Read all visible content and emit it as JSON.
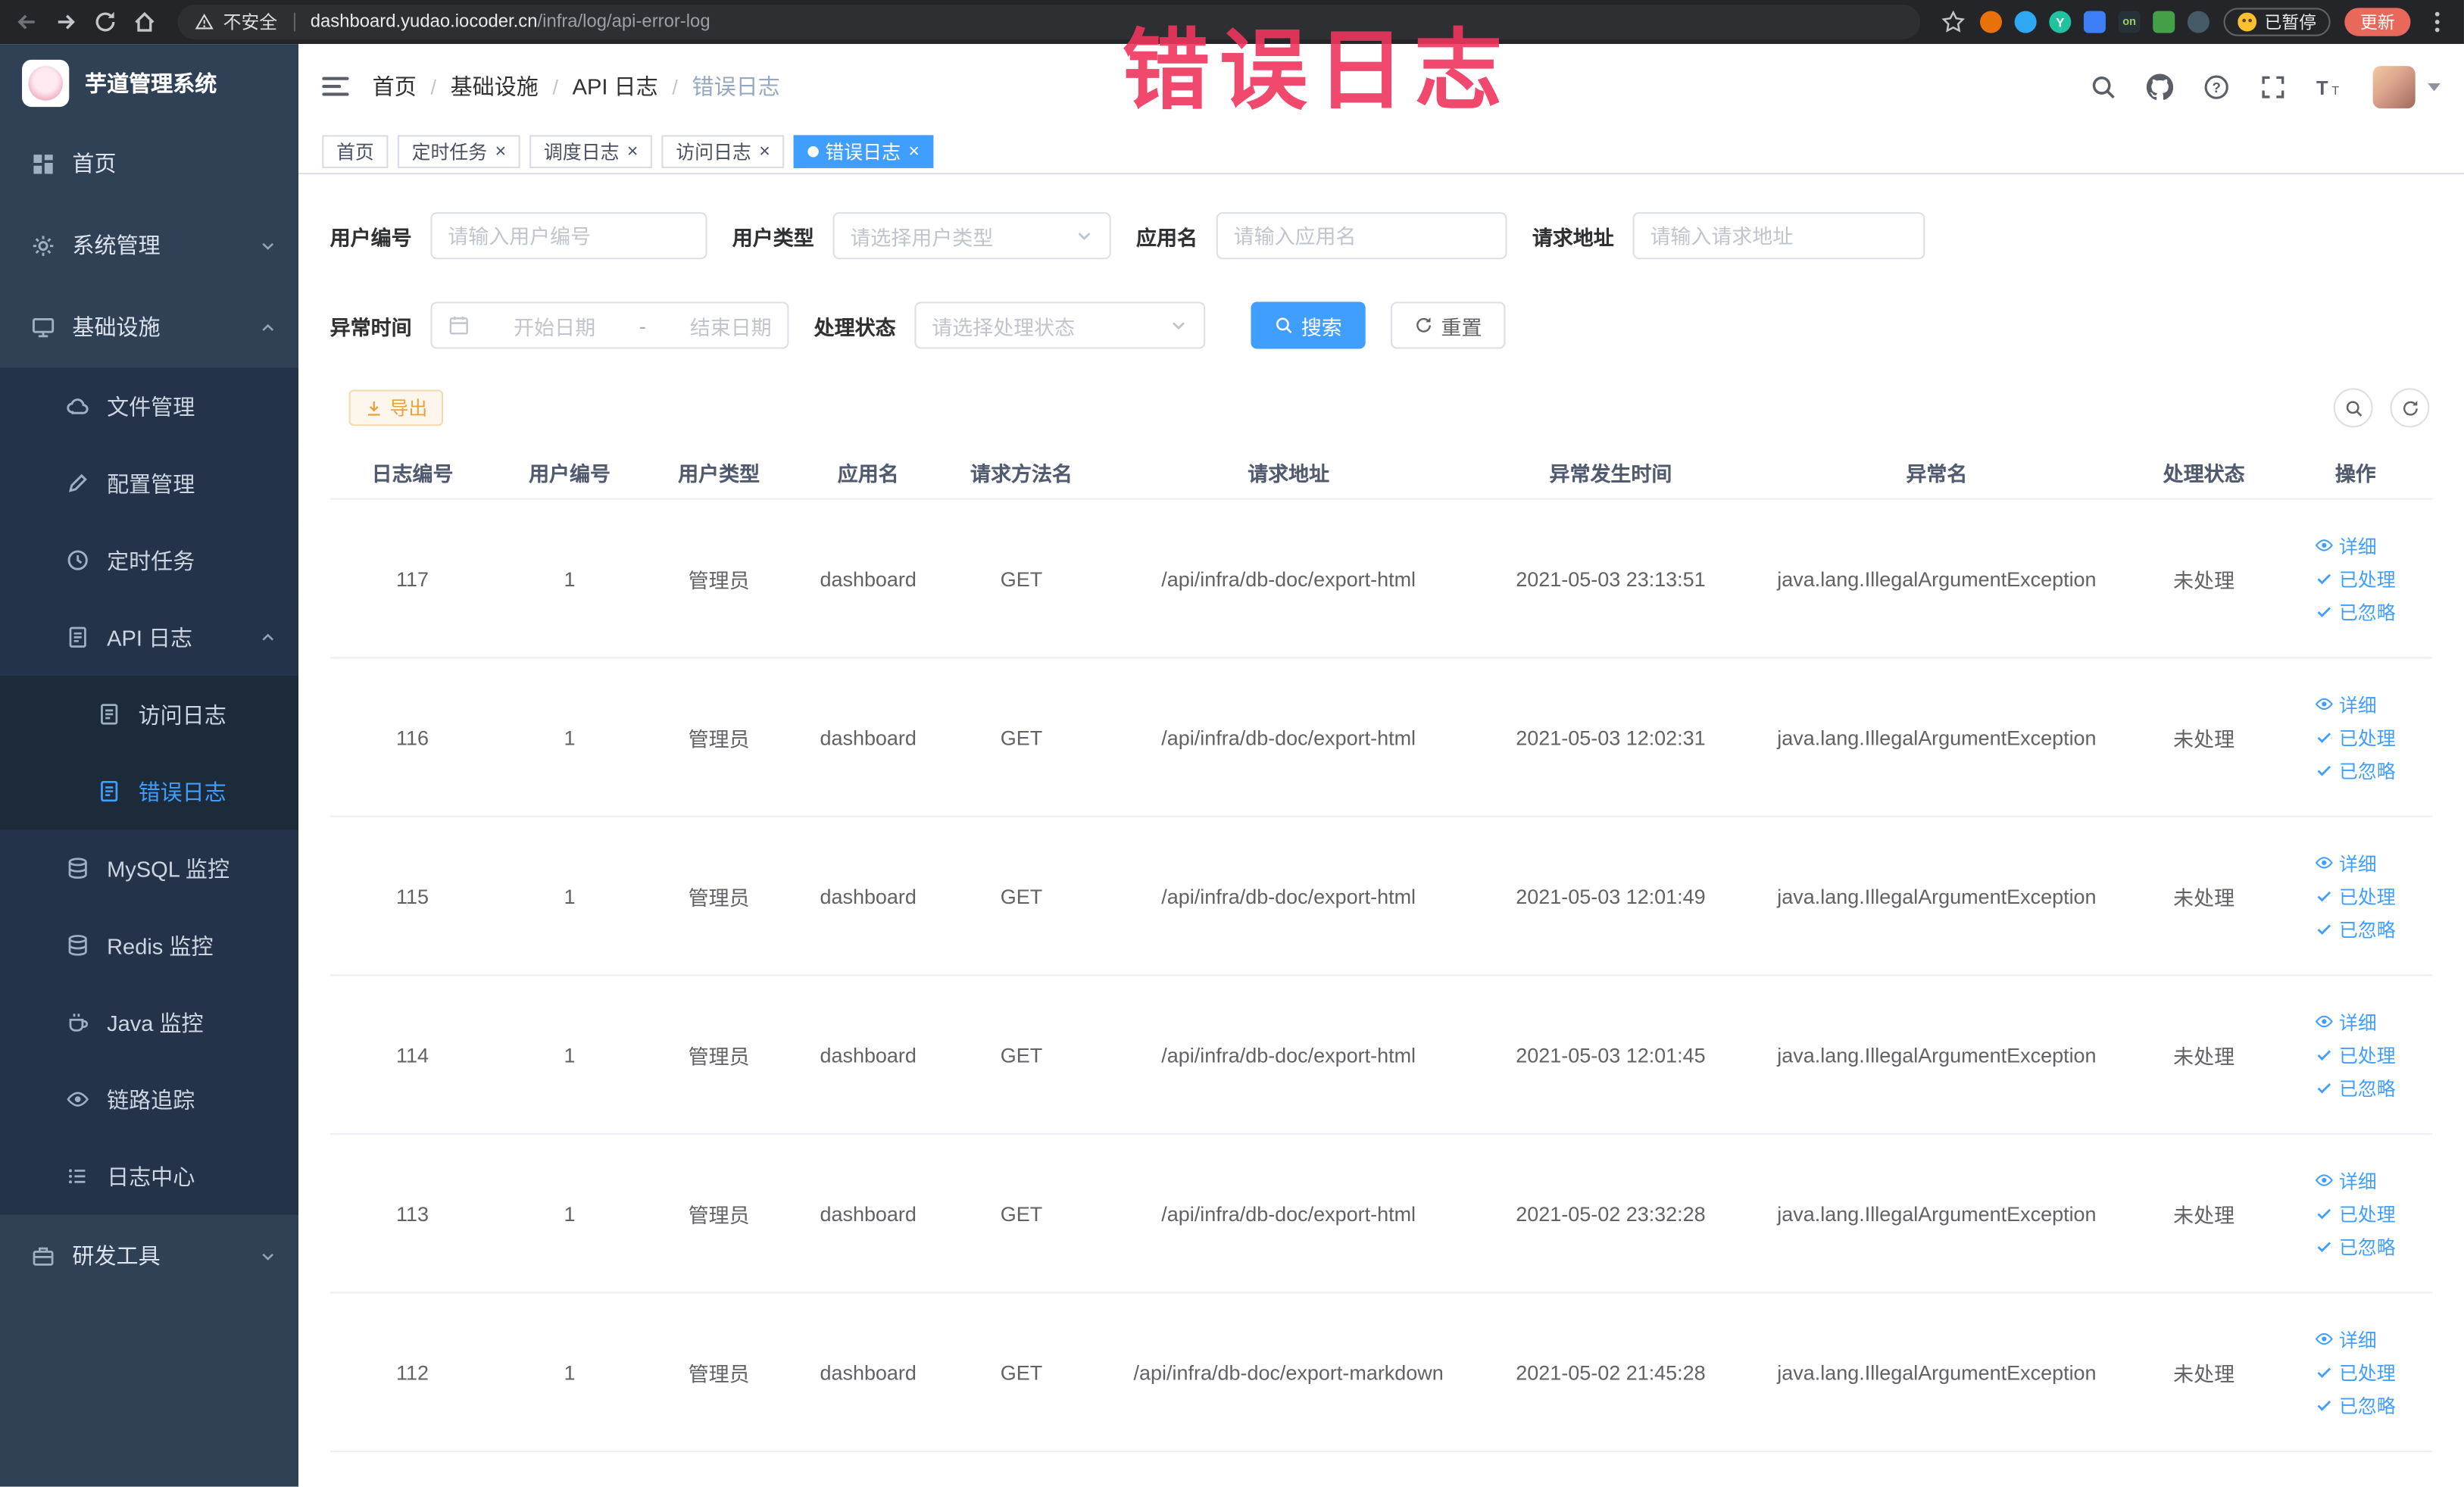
{
  "colors": {
    "primary": "#409eff",
    "sidebar_bg": "#304156",
    "annotation": "#f0355e",
    "warning_action": "#e6a23c",
    "active_tab_bg": "#409eff"
  },
  "browser": {
    "security_label": "不安全",
    "url_host": "dashboard.yudao.iocoder.cn",
    "url_path": "/infra/log/api-error-log",
    "paused_label": "已暂停",
    "update_label": "更新",
    "extensions": [
      "orange-extension-icon",
      "drop-extension-icon",
      "yudao-extension-icon",
      "grid-extension-icon",
      "on-extension-icon",
      "leaf-extension-icon",
      "paw-extension-icon"
    ]
  },
  "annotation": {
    "text": "错误日志"
  },
  "sidebar": {
    "logo_title": "芋道管理系统",
    "items": [
      {
        "name": "home",
        "label": "首页",
        "icon": "dashboard-icon",
        "level": 1
      },
      {
        "name": "system",
        "label": "系统管理",
        "icon": "gear-icon",
        "level": 1,
        "chevron": "down"
      },
      {
        "name": "infra",
        "label": "基础设施",
        "icon": "infra-icon",
        "level": 1,
        "chevron": "up"
      },
      {
        "name": "files",
        "label": "文件管理",
        "icon": "cloud-icon",
        "level": 2
      },
      {
        "name": "config",
        "label": "配置管理",
        "icon": "pencil-icon",
        "level": 2
      },
      {
        "name": "cron-job",
        "label": "定时任务",
        "icon": "clock-icon",
        "level": 2
      },
      {
        "name": "api-log",
        "label": "API 日志",
        "icon": "doc-icon",
        "level": 2,
        "chevron": "up"
      },
      {
        "name": "access-log",
        "label": "访问日志",
        "icon": "doc-icon",
        "level": 3
      },
      {
        "name": "error-log",
        "label": "错误日志",
        "icon": "doc-icon",
        "level": 3,
        "active": true
      },
      {
        "name": "mysql-monitor",
        "label": "MySQL 监控",
        "icon": "db-icon",
        "level": 2
      },
      {
        "name": "redis-monitor",
        "label": "Redis 监控",
        "icon": "db-icon",
        "level": 2
      },
      {
        "name": "java-monitor",
        "label": "Java 监控",
        "icon": "cup-icon",
        "level": 2
      },
      {
        "name": "trace",
        "label": "链路追踪",
        "icon": "eye-icon",
        "level": 2
      },
      {
        "name": "log-center",
        "label": "日志中心",
        "icon": "list-icon",
        "level": 2
      },
      {
        "name": "devtools",
        "label": "研发工具",
        "icon": "tools-icon",
        "level": 1,
        "chevron": "down"
      }
    ]
  },
  "header": {
    "breadcrumbs": [
      "首页",
      "基础设施",
      "API 日志",
      "错误日志"
    ],
    "separator": "/"
  },
  "tabs": [
    {
      "name": "home",
      "label": "首页",
      "closable": false,
      "active": false
    },
    {
      "name": "cron-job",
      "label": "定时任务",
      "closable": true,
      "active": false
    },
    {
      "name": "schedule-log",
      "label": "调度日志",
      "closable": true,
      "active": false
    },
    {
      "name": "access-log",
      "label": "访问日志",
      "closable": true,
      "active": false
    },
    {
      "name": "error-log",
      "label": "错误日志",
      "closable": true,
      "active": true
    }
  ],
  "filters": {
    "user_id": {
      "label": "用户编号",
      "placeholder": "请输入用户编号"
    },
    "user_type": {
      "label": "用户类型",
      "placeholder": "请选择用户类型"
    },
    "app_name": {
      "label": "应用名",
      "placeholder": "请输入应用名"
    },
    "request_url": {
      "label": "请求地址",
      "placeholder": "请输入请求地址"
    },
    "exception_time": {
      "label": "异常时间",
      "start_placeholder": "开始日期",
      "separator": "-",
      "end_placeholder": "结束日期"
    },
    "process_status": {
      "label": "处理状态",
      "placeholder": "请选择处理状态"
    },
    "search_label": "搜索",
    "reset_label": "重置"
  },
  "toolbar": {
    "export_label": "导出"
  },
  "table": {
    "columns": [
      "日志编号",
      "用户编号",
      "用户类型",
      "应用名",
      "请求方法名",
      "请求地址",
      "异常发生时间",
      "异常名",
      "处理状态",
      "操作"
    ],
    "actions": [
      "详细",
      "已处理",
      "已忽略"
    ],
    "rows": [
      {
        "id": "117",
        "user_id": "1",
        "user_type": "管理员",
        "app": "dashboard",
        "method": "GET",
        "url": "/api/infra/db-doc/export-html",
        "time": "2021-05-03 23:13:51",
        "exception": "java.lang.IllegalArgumentException",
        "status": "未处理"
      },
      {
        "id": "116",
        "user_id": "1",
        "user_type": "管理员",
        "app": "dashboard",
        "method": "GET",
        "url": "/api/infra/db-doc/export-html",
        "time": "2021-05-03 12:02:31",
        "exception": "java.lang.IllegalArgumentException",
        "status": "未处理"
      },
      {
        "id": "115",
        "user_id": "1",
        "user_type": "管理员",
        "app": "dashboard",
        "method": "GET",
        "url": "/api/infra/db-doc/export-html",
        "time": "2021-05-03 12:01:49",
        "exception": "java.lang.IllegalArgumentException",
        "status": "未处理"
      },
      {
        "id": "114",
        "user_id": "1",
        "user_type": "管理员",
        "app": "dashboard",
        "method": "GET",
        "url": "/api/infra/db-doc/export-html",
        "time": "2021-05-03 12:01:45",
        "exception": "java.lang.IllegalArgumentException",
        "status": "未处理"
      },
      {
        "id": "113",
        "user_id": "1",
        "user_type": "管理员",
        "app": "dashboard",
        "method": "GET",
        "url": "/api/infra/db-doc/export-html",
        "time": "2021-05-02 23:32:28",
        "exception": "java.lang.IllegalArgumentException",
        "status": "未处理"
      },
      {
        "id": "112",
        "user_id": "1",
        "user_type": "管理员",
        "app": "dashboard",
        "method": "GET",
        "url": "/api/infra/db-doc/export-markdown",
        "time": "2021-05-02 21:45:28",
        "exception": "java.lang.IllegalArgumentException",
        "status": "未处理"
      }
    ]
  }
}
